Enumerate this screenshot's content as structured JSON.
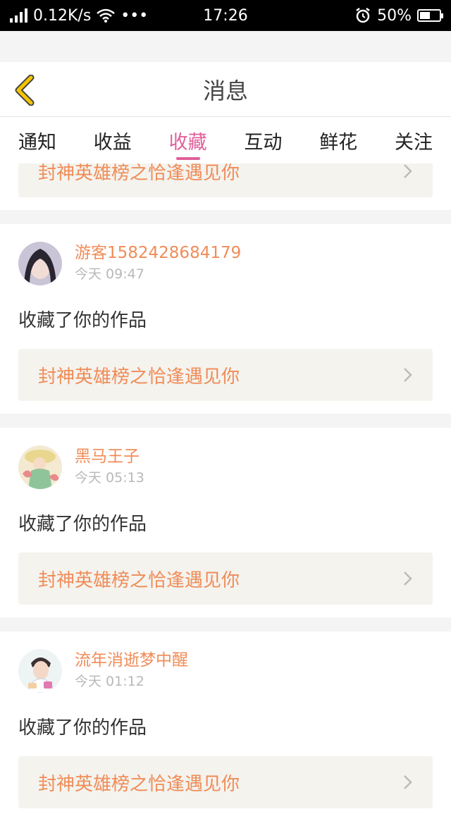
{
  "status_bar": {
    "network_speed": "0.12K/s",
    "time": "17:26",
    "battery": "50%",
    "battery_level": 0.5,
    "more": "•••"
  },
  "header": {
    "title": "消息"
  },
  "tabs": [
    {
      "label": "通知",
      "active": false
    },
    {
      "label": "收益",
      "active": false
    },
    {
      "label": "收藏",
      "active": true
    },
    {
      "label": "互动",
      "active": false
    },
    {
      "label": "鲜花",
      "active": false
    },
    {
      "label": "关注",
      "active": false
    }
  ],
  "partial_card": {
    "work_title": "封神英雄榜之恰逢遇见你"
  },
  "cards": [
    {
      "user": "游客1582428684179",
      "time": "今天 09:47",
      "action": "收藏了你的作品",
      "work_title": "封神英雄榜之恰逢遇见你"
    },
    {
      "user": "黑马王子",
      "time": "今天 05:13",
      "action": "收藏了你的作品",
      "work_title": "封神英雄榜之恰逢遇见你"
    },
    {
      "user": "流年消逝梦中醒",
      "time": "今天 01:12",
      "action": "收藏了你的作品",
      "work_title": "封神英雄榜之恰逢遇见你"
    }
  ],
  "colors": {
    "accent": "#e0609a",
    "link_orange": "#f08c58",
    "back_yellow": "#f5c400"
  }
}
